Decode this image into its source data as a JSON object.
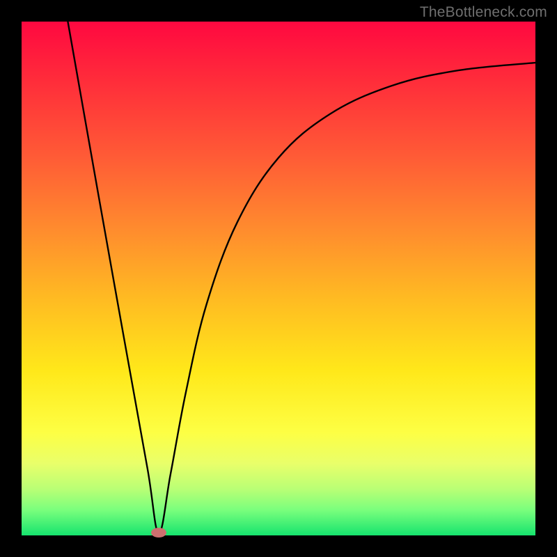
{
  "watermark": "TheBottleneck.com",
  "chart_data": {
    "type": "line",
    "title": "",
    "xlabel": "",
    "ylabel": "",
    "xlim": [
      0,
      100
    ],
    "ylim": [
      0,
      100
    ],
    "grid": false,
    "legend": false,
    "series": [
      {
        "name": "curve",
        "x": [
          9.0,
          15.0,
          20.0,
          24.5,
          26.7,
          29.0,
          32.0,
          36.0,
          42.0,
          50.0,
          60.0,
          72.0,
          85.0,
          100.0
        ],
        "y": [
          100.0,
          66.0,
          38.0,
          13.0,
          0.5,
          12.0,
          28.0,
          45.0,
          61.0,
          73.5,
          82.0,
          87.5,
          90.5,
          92.0
        ]
      }
    ],
    "min_marker": {
      "x": 26.7,
      "y": 0.5,
      "color": "#cd6f6f"
    },
    "background_gradient": {
      "direction": "vertical",
      "stops": [
        {
          "pos": 0.0,
          "color": "#ff0840"
        },
        {
          "pos": 0.12,
          "color": "#ff2e3a"
        },
        {
          "pos": 0.26,
          "color": "#ff5a36"
        },
        {
          "pos": 0.4,
          "color": "#ff8a2e"
        },
        {
          "pos": 0.54,
          "color": "#ffbb22"
        },
        {
          "pos": 0.68,
          "color": "#ffe81a"
        },
        {
          "pos": 0.8,
          "color": "#fdff44"
        },
        {
          "pos": 0.86,
          "color": "#e9ff6a"
        },
        {
          "pos": 0.91,
          "color": "#b9ff75"
        },
        {
          "pos": 0.95,
          "color": "#7bff7d"
        },
        {
          "pos": 1.0,
          "color": "#16e46e"
        }
      ]
    }
  }
}
